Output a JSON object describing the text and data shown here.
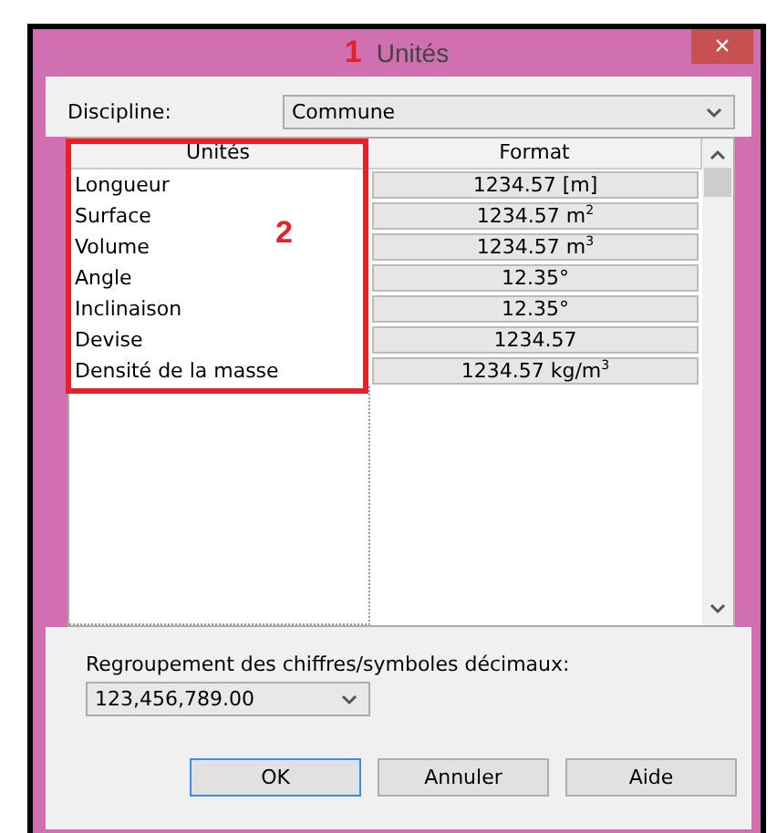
{
  "window": {
    "title": "Unités",
    "close": "×"
  },
  "annotations": [
    {
      "label": "1"
    },
    {
      "label": "2"
    }
  ],
  "discipline": {
    "label": "Discipline:",
    "value": "Commune"
  },
  "table": {
    "columns": [
      "Unités",
      "Format"
    ],
    "rows": [
      {
        "unit": "Longueur",
        "format": "1234.57 [m]"
      },
      {
        "unit": "Surface",
        "format": "1234.57 m$^{2}$"
      },
      {
        "unit": "Volume",
        "format": "1234.57 m$^{3}$"
      },
      {
        "unit": "Angle",
        "format": "12.35°"
      },
      {
        "unit": "Inclinaison",
        "format": "12.35°"
      },
      {
        "unit": "Devise",
        "format": "1234.57"
      },
      {
        "unit": "Densité de la masse",
        "format": "1234.57 kg/m$^{3}$"
      }
    ]
  },
  "grouping": {
    "label": "Regroupement des chiffres/symboles décimaux:",
    "value": "123,456,789.00"
  },
  "buttons": [
    {
      "label": "OK",
      "default": true
    },
    {
      "label": "Annuler",
      "default": false
    },
    {
      "label": "Aide",
      "default": false
    }
  ]
}
